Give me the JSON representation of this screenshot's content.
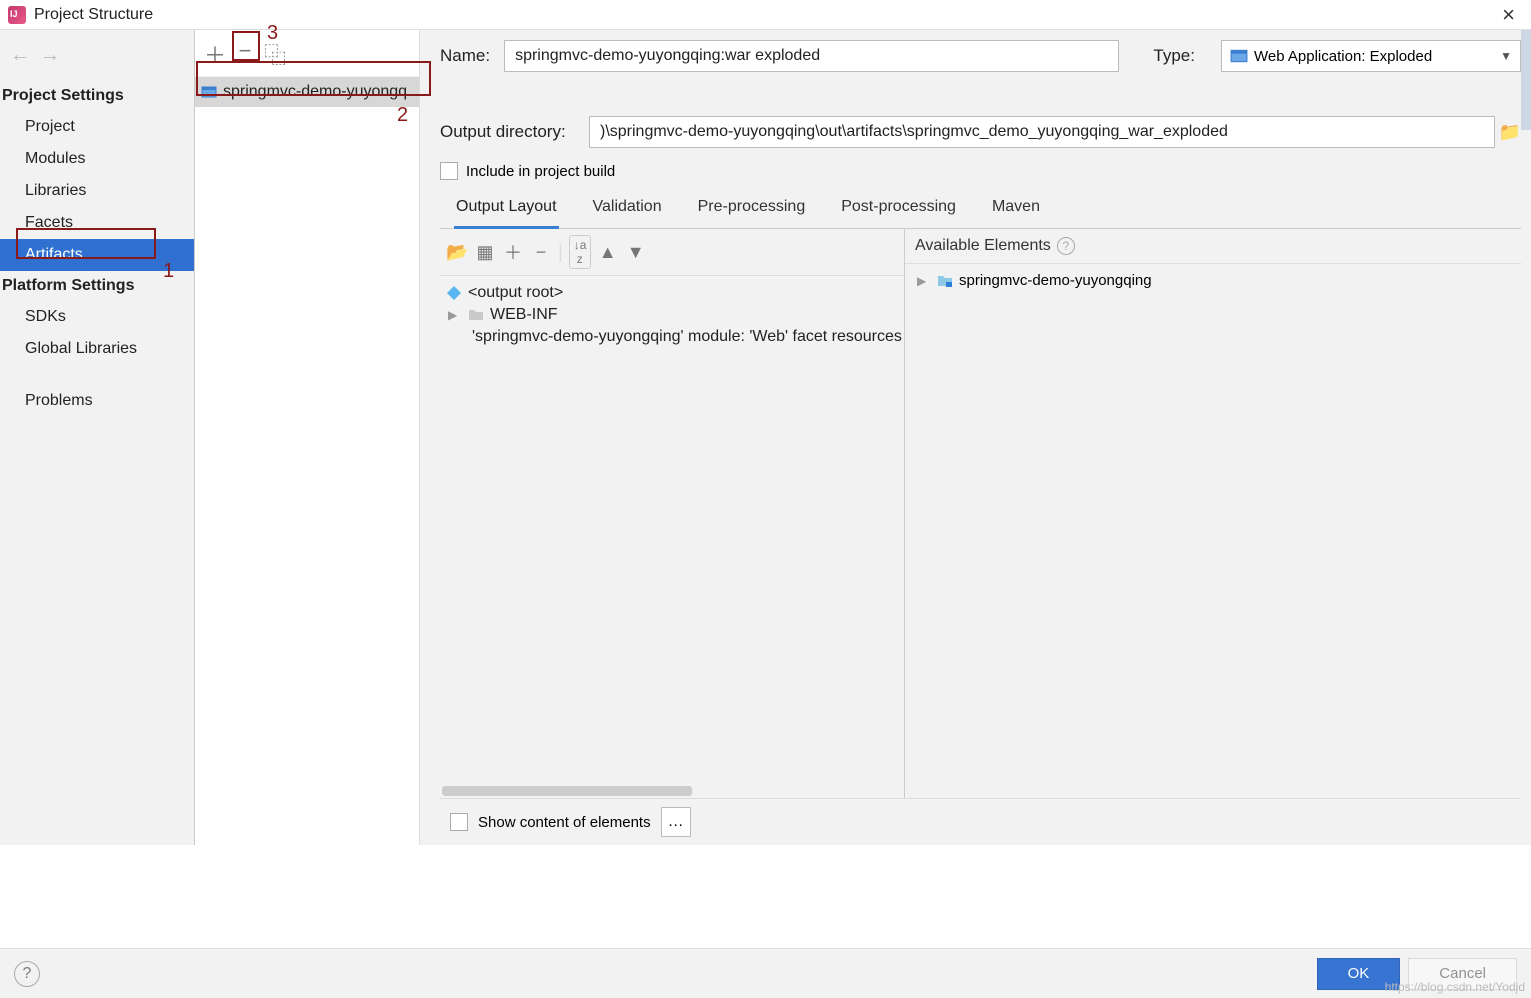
{
  "window": {
    "title": "Project Structure"
  },
  "annotations": {
    "a1": "1",
    "a2": "2",
    "a3": "3"
  },
  "sidebar": {
    "sections": [
      {
        "title": "Project Settings",
        "items": [
          "Project",
          "Modules",
          "Libraries",
          "Facets",
          "Artifacts"
        ],
        "selected": 4
      },
      {
        "title": "Platform Settings",
        "items": [
          "SDKs",
          "Global Libraries"
        ]
      }
    ],
    "extra": [
      "Problems"
    ]
  },
  "artifacts": {
    "list": [
      {
        "label": "springmvc-demo-yuyongq"
      }
    ]
  },
  "detail": {
    "name_label": "Name:",
    "name_value": "springmvc-demo-yuyongqing:war exploded",
    "type_label": "Type:",
    "type_value": "Web Application: Exploded",
    "output_label": "Output directory:",
    "output_value": ")\\springmvc-demo-yuyongqing\\out\\artifacts\\springmvc_demo_yuyongqing_war_exploded",
    "include_label": "Include in project build",
    "tabs": [
      "Output Layout",
      "Validation",
      "Pre-processing",
      "Post-processing",
      "Maven"
    ],
    "active_tab": 0,
    "output_tree": {
      "root": "<output root>",
      "items": [
        {
          "label": "WEB-INF",
          "type": "folder"
        },
        {
          "label": "'springmvc-demo-yuyongqing' module: 'Web' facet resources",
          "type": "facet"
        }
      ]
    },
    "available_label": "Available Elements",
    "available_items": [
      {
        "label": "springmvc-demo-yuyongqing"
      }
    ],
    "show_content_label": "Show content of elements"
  },
  "footer": {
    "ok": "OK",
    "cancel": "Cancel"
  },
  "watermark": "https://blog.csdn.net/Yodjd"
}
